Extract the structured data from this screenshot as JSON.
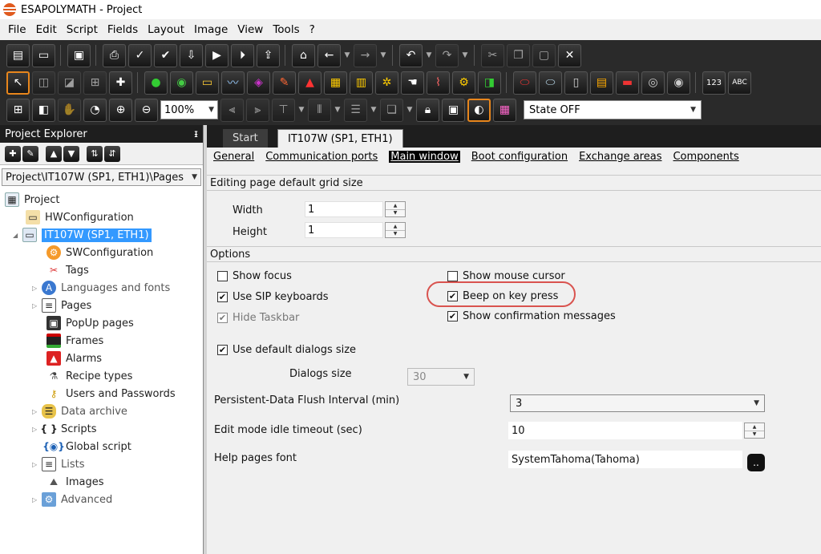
{
  "app": {
    "title": "ESAPOLYMATH - Project"
  },
  "menu": [
    "File",
    "Edit",
    "Script",
    "Fields",
    "Layout",
    "Image",
    "View",
    "Tools",
    "?"
  ],
  "toolbar": {
    "zoom": "100%",
    "state": "State OFF"
  },
  "explorer": {
    "title": "Project Explorer",
    "pin_glyph": "ᵻ",
    "path": "Project\\IT107W (SP1, ETH1)\\Pages",
    "tree": {
      "project": "Project",
      "hwconfig": "HWConfiguration",
      "device": "IT107W (SP1, ETH1)",
      "swconfig": "SWConfiguration",
      "tags": "Tags",
      "languages": "Languages and fonts",
      "pages": "Pages",
      "popup": "PopUp pages",
      "frames": "Frames",
      "alarms": "Alarms",
      "recipes": "Recipe types",
      "users": "Users and Passwords",
      "archive": "Data archive",
      "scripts": "Scripts",
      "global_script": "Global script",
      "lists": "Lists",
      "images": "Images",
      "advanced": "Advanced"
    }
  },
  "tabs": {
    "start": "Start",
    "device": "IT107W (SP1, ETH1)"
  },
  "subnav": [
    "General",
    "Communication ports",
    "Main window",
    "Boot configuration",
    "Exchange areas",
    "Components"
  ],
  "grid": {
    "section": "Editing page default grid size",
    "width_label": "Width",
    "width_value": "1",
    "height_label": "Height",
    "height_value": "1"
  },
  "options": {
    "section": "Options",
    "show_focus": "Show focus",
    "use_sip": "Use SIP keyboards",
    "hide_taskbar": "Hide Taskbar",
    "show_mouse": "Show mouse cursor",
    "beep": "Beep on key press",
    "show_confirm": "Show confirmation messages",
    "default_dialogs": "Use default dialogs size",
    "dialogs_size_label": "Dialogs size",
    "dialogs_size_value": "30",
    "flush_label": "Persistent-Data Flush Interval (min)",
    "flush_value": "3",
    "idle_label": "Edit mode idle timeout (sec)",
    "idle_value": "10",
    "help_font_label": "Help pages font",
    "help_font_value": "SystemTahoma(Tahoma)",
    "font_button": ".."
  },
  "checkbox_states": {
    "show_focus": false,
    "use_sip": true,
    "hide_taskbar": true,
    "show_mouse": false,
    "beep": true,
    "show_confirm": true,
    "default_dialogs": true
  },
  "colors": {
    "highlight": "#d9534f",
    "selection": "#3399ff",
    "toolbar_bg": "#2a2a2a",
    "active_tool_border": "#e8861c"
  }
}
